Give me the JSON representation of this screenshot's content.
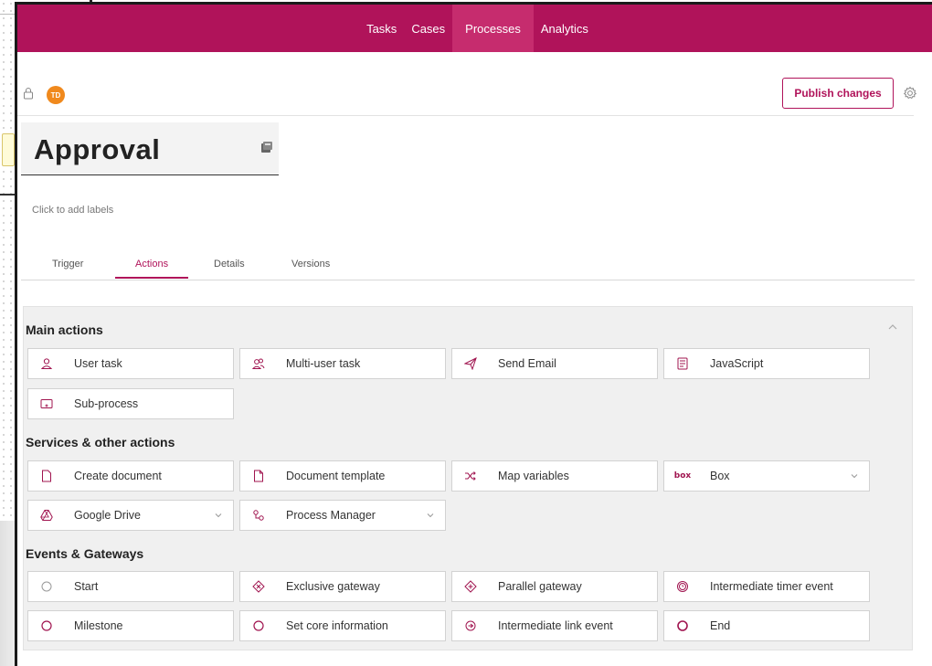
{
  "nav": {
    "items": [
      {
        "label": "Tasks"
      },
      {
        "label": "Cases"
      },
      {
        "label": "Processes",
        "active": true
      },
      {
        "label": "Analytics"
      }
    ],
    "color": "#b0135a"
  },
  "header": {
    "avatar_initials": "TD",
    "publish_label": "Publish changes"
  },
  "process": {
    "title": "Approval",
    "labels_placeholder": "Click to add labels"
  },
  "tabs": [
    {
      "label": "Trigger"
    },
    {
      "label": "Actions",
      "active": true
    },
    {
      "label": "Details"
    },
    {
      "label": "Versions"
    }
  ],
  "sections": {
    "main": {
      "title": "Main actions",
      "items": [
        {
          "label": "User task",
          "icon": "user-icon"
        },
        {
          "label": "Multi-user task",
          "icon": "multi-user-icon"
        },
        {
          "label": "Send Email",
          "icon": "send-icon"
        },
        {
          "label": "JavaScript",
          "icon": "script-icon"
        },
        {
          "label": "Sub-process",
          "icon": "subprocess-icon"
        }
      ]
    },
    "services": {
      "title": "Services & other actions",
      "items": [
        {
          "label": "Create document",
          "icon": "document-icon"
        },
        {
          "label": "Document template",
          "icon": "document-template-icon"
        },
        {
          "label": "Map variables",
          "icon": "shuffle-icon"
        },
        {
          "label": "Box",
          "icon": "box-logo-icon",
          "logo_text": "box",
          "dropdown": true
        },
        {
          "label": "Google Drive",
          "icon": "google-drive-icon",
          "dropdown": true
        },
        {
          "label": "Process Manager",
          "icon": "process-manager-icon",
          "dropdown": true
        }
      ]
    },
    "events": {
      "title": "Events & Gateways",
      "items": [
        {
          "label": "Start",
          "icon": "start-event-icon"
        },
        {
          "label": "Exclusive gateway",
          "icon": "exclusive-gateway-icon"
        },
        {
          "label": "Parallel gateway",
          "icon": "parallel-gateway-icon"
        },
        {
          "label": "Intermediate timer event",
          "icon": "timer-event-icon"
        },
        {
          "label": "Milestone",
          "icon": "milestone-icon"
        },
        {
          "label": "Set core information",
          "icon": "set-core-information-icon"
        },
        {
          "label": "Intermediate link event",
          "icon": "link-event-icon"
        },
        {
          "label": "End",
          "icon": "end-event-icon"
        }
      ]
    }
  }
}
